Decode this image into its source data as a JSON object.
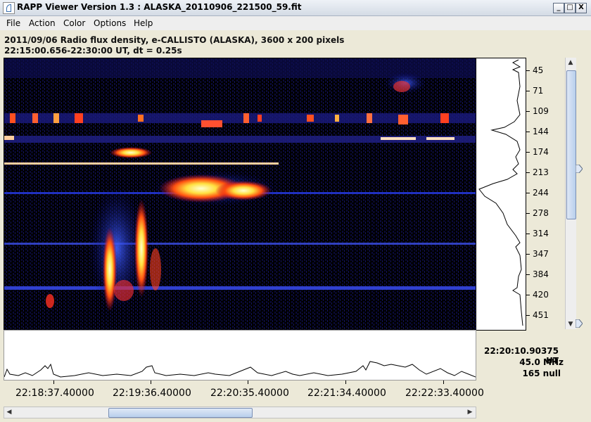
{
  "window": {
    "title": "RAPP Viewer Version 1.3 : ALASKA_20110906_221500_59.fit",
    "minimize_glyph": "_",
    "maximize_glyph": "□",
    "close_glyph": "X"
  },
  "menu": [
    "File",
    "Action",
    "Color",
    "Options",
    "Help"
  ],
  "info": {
    "line1": "2011/09/06  Radio flux density, e-CALLISTO (ALASKA),  3600 x 200 pixels",
    "line2": "22:15:00.656-22:30:00 UT,  dt = 0.25s"
  },
  "freq_axis": {
    "labels": [
      "45",
      "71",
      "109",
      "144",
      "174",
      "213",
      "244",
      "278",
      "314",
      "347",
      "384",
      "420",
      "451"
    ]
  },
  "time_axis": {
    "labels": [
      "22:18:37.40000",
      "22:19:36.40000",
      "22:20:35.40000",
      "22:21:34.40000",
      "22:22:33.40000"
    ]
  },
  "readout": {
    "time": "22:20:10.90375 UT",
    "freq": "45.0 MHz",
    "value": "165 null"
  },
  "colors": {
    "spectrogram_background": "#000000",
    "accent": "#3a6fb0"
  },
  "icons": {
    "app": "java-cup-icon",
    "scroll_up": "arrow-up-icon",
    "scroll_down": "arrow-down-icon",
    "scroll_left": "arrow-left-icon",
    "scroll_right": "arrow-right-icon"
  }
}
